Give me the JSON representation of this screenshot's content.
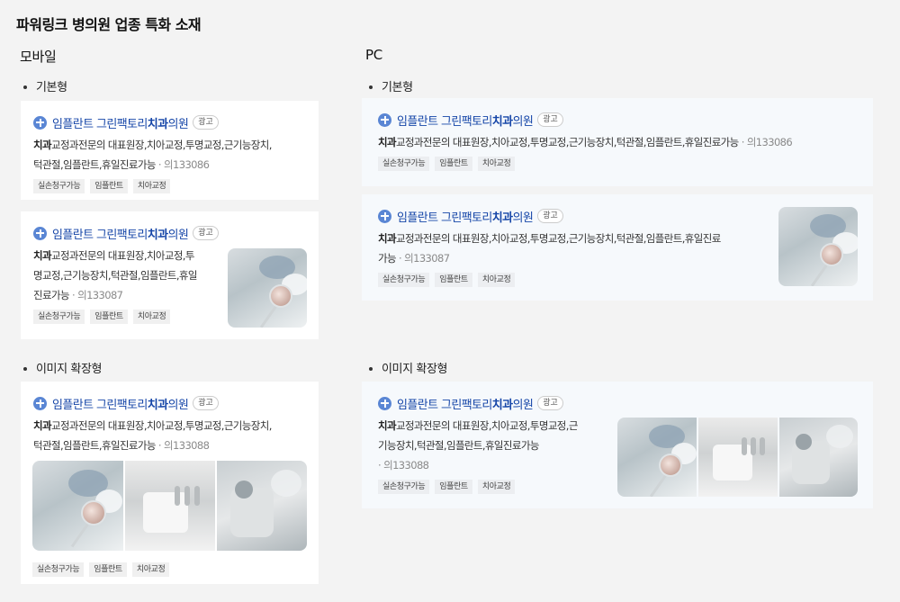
{
  "page_title": "파워링크 병의원 업종 특화 소재",
  "mobile": {
    "column_title": "모바일",
    "basic_label": "기본형",
    "image_label": "이미지 확장형"
  },
  "pc": {
    "column_title": "PC",
    "basic_label": "기본형",
    "image_label": "이미지 확장형"
  },
  "ad": {
    "title_pre": "임플란트 그린팩토리",
    "title_bold": "치과",
    "title_post": "의원",
    "ad_badge": "광고",
    "desc_bold": "치과",
    "desc_rest": "교정과전문의 대표원장,치아교정,투명교정,근기능장치,턱관절,임플란트,휴일진료가능",
    "permit": "· 의133086",
    "permit_alt": "· 의133087",
    "permit_img": "· 의133088",
    "tags": [
      "실손청구가능",
      "임플란트",
      "치아교정"
    ]
  },
  "m2_lines": [
    "교정과전문의 대표원장,치아교정,투",
    "명교정,근기능장치,턱관절,임플란트,휴일",
    "진료가능"
  ],
  "m_lines": [
    "교정과전문의 대표원장,치아교정,투명교정,근기능장치,",
    "턱관절,임플란트,휴일진료가능"
  ],
  "pc2_lines": [
    "교정과전문의 대표원장,치아교정,투명교정,근기능장치,턱관절,임플란트,휴일진료",
    "가능"
  ],
  "pc3_lines": [
    "교정과전문의 대표원장,치아교정,투명교정,근",
    "기능장치,턱관절,임플란트,휴일진료가능"
  ],
  "colors": {
    "title_blue": "#1646a8",
    "plus_blue": "#5a86d4",
    "bg": "#f3f3f3",
    "pc_card": "#f6f9fc"
  }
}
